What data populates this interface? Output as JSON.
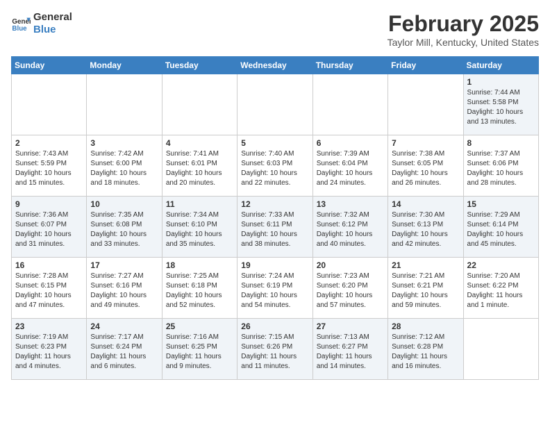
{
  "header": {
    "logo_line1": "General",
    "logo_line2": "Blue",
    "month": "February 2025",
    "location": "Taylor Mill, Kentucky, United States"
  },
  "weekdays": [
    "Sunday",
    "Monday",
    "Tuesday",
    "Wednesday",
    "Thursday",
    "Friday",
    "Saturday"
  ],
  "weeks": [
    [
      {
        "num": "",
        "info": ""
      },
      {
        "num": "",
        "info": ""
      },
      {
        "num": "",
        "info": ""
      },
      {
        "num": "",
        "info": ""
      },
      {
        "num": "",
        "info": ""
      },
      {
        "num": "",
        "info": ""
      },
      {
        "num": "1",
        "info": "Sunrise: 7:44 AM\nSunset: 5:58 PM\nDaylight: 10 hours and 13 minutes."
      }
    ],
    [
      {
        "num": "2",
        "info": "Sunrise: 7:43 AM\nSunset: 5:59 PM\nDaylight: 10 hours and 15 minutes."
      },
      {
        "num": "3",
        "info": "Sunrise: 7:42 AM\nSunset: 6:00 PM\nDaylight: 10 hours and 18 minutes."
      },
      {
        "num": "4",
        "info": "Sunrise: 7:41 AM\nSunset: 6:01 PM\nDaylight: 10 hours and 20 minutes."
      },
      {
        "num": "5",
        "info": "Sunrise: 7:40 AM\nSunset: 6:03 PM\nDaylight: 10 hours and 22 minutes."
      },
      {
        "num": "6",
        "info": "Sunrise: 7:39 AM\nSunset: 6:04 PM\nDaylight: 10 hours and 24 minutes."
      },
      {
        "num": "7",
        "info": "Sunrise: 7:38 AM\nSunset: 6:05 PM\nDaylight: 10 hours and 26 minutes."
      },
      {
        "num": "8",
        "info": "Sunrise: 7:37 AM\nSunset: 6:06 PM\nDaylight: 10 hours and 28 minutes."
      }
    ],
    [
      {
        "num": "9",
        "info": "Sunrise: 7:36 AM\nSunset: 6:07 PM\nDaylight: 10 hours and 31 minutes."
      },
      {
        "num": "10",
        "info": "Sunrise: 7:35 AM\nSunset: 6:08 PM\nDaylight: 10 hours and 33 minutes."
      },
      {
        "num": "11",
        "info": "Sunrise: 7:34 AM\nSunset: 6:10 PM\nDaylight: 10 hours and 35 minutes."
      },
      {
        "num": "12",
        "info": "Sunrise: 7:33 AM\nSunset: 6:11 PM\nDaylight: 10 hours and 38 minutes."
      },
      {
        "num": "13",
        "info": "Sunrise: 7:32 AM\nSunset: 6:12 PM\nDaylight: 10 hours and 40 minutes."
      },
      {
        "num": "14",
        "info": "Sunrise: 7:30 AM\nSunset: 6:13 PM\nDaylight: 10 hours and 42 minutes."
      },
      {
        "num": "15",
        "info": "Sunrise: 7:29 AM\nSunset: 6:14 PM\nDaylight: 10 hours and 45 minutes."
      }
    ],
    [
      {
        "num": "16",
        "info": "Sunrise: 7:28 AM\nSunset: 6:15 PM\nDaylight: 10 hours and 47 minutes."
      },
      {
        "num": "17",
        "info": "Sunrise: 7:27 AM\nSunset: 6:16 PM\nDaylight: 10 hours and 49 minutes."
      },
      {
        "num": "18",
        "info": "Sunrise: 7:25 AM\nSunset: 6:18 PM\nDaylight: 10 hours and 52 minutes."
      },
      {
        "num": "19",
        "info": "Sunrise: 7:24 AM\nSunset: 6:19 PM\nDaylight: 10 hours and 54 minutes."
      },
      {
        "num": "20",
        "info": "Sunrise: 7:23 AM\nSunset: 6:20 PM\nDaylight: 10 hours and 57 minutes."
      },
      {
        "num": "21",
        "info": "Sunrise: 7:21 AM\nSunset: 6:21 PM\nDaylight: 10 hours and 59 minutes."
      },
      {
        "num": "22",
        "info": "Sunrise: 7:20 AM\nSunset: 6:22 PM\nDaylight: 11 hours and 1 minute."
      }
    ],
    [
      {
        "num": "23",
        "info": "Sunrise: 7:19 AM\nSunset: 6:23 PM\nDaylight: 11 hours and 4 minutes."
      },
      {
        "num": "24",
        "info": "Sunrise: 7:17 AM\nSunset: 6:24 PM\nDaylight: 11 hours and 6 minutes."
      },
      {
        "num": "25",
        "info": "Sunrise: 7:16 AM\nSunset: 6:25 PM\nDaylight: 11 hours and 9 minutes."
      },
      {
        "num": "26",
        "info": "Sunrise: 7:15 AM\nSunset: 6:26 PM\nDaylight: 11 hours and 11 minutes."
      },
      {
        "num": "27",
        "info": "Sunrise: 7:13 AM\nSunset: 6:27 PM\nDaylight: 11 hours and 14 minutes."
      },
      {
        "num": "28",
        "info": "Sunrise: 7:12 AM\nSunset: 6:28 PM\nDaylight: 11 hours and 16 minutes."
      },
      {
        "num": "",
        "info": ""
      }
    ]
  ]
}
